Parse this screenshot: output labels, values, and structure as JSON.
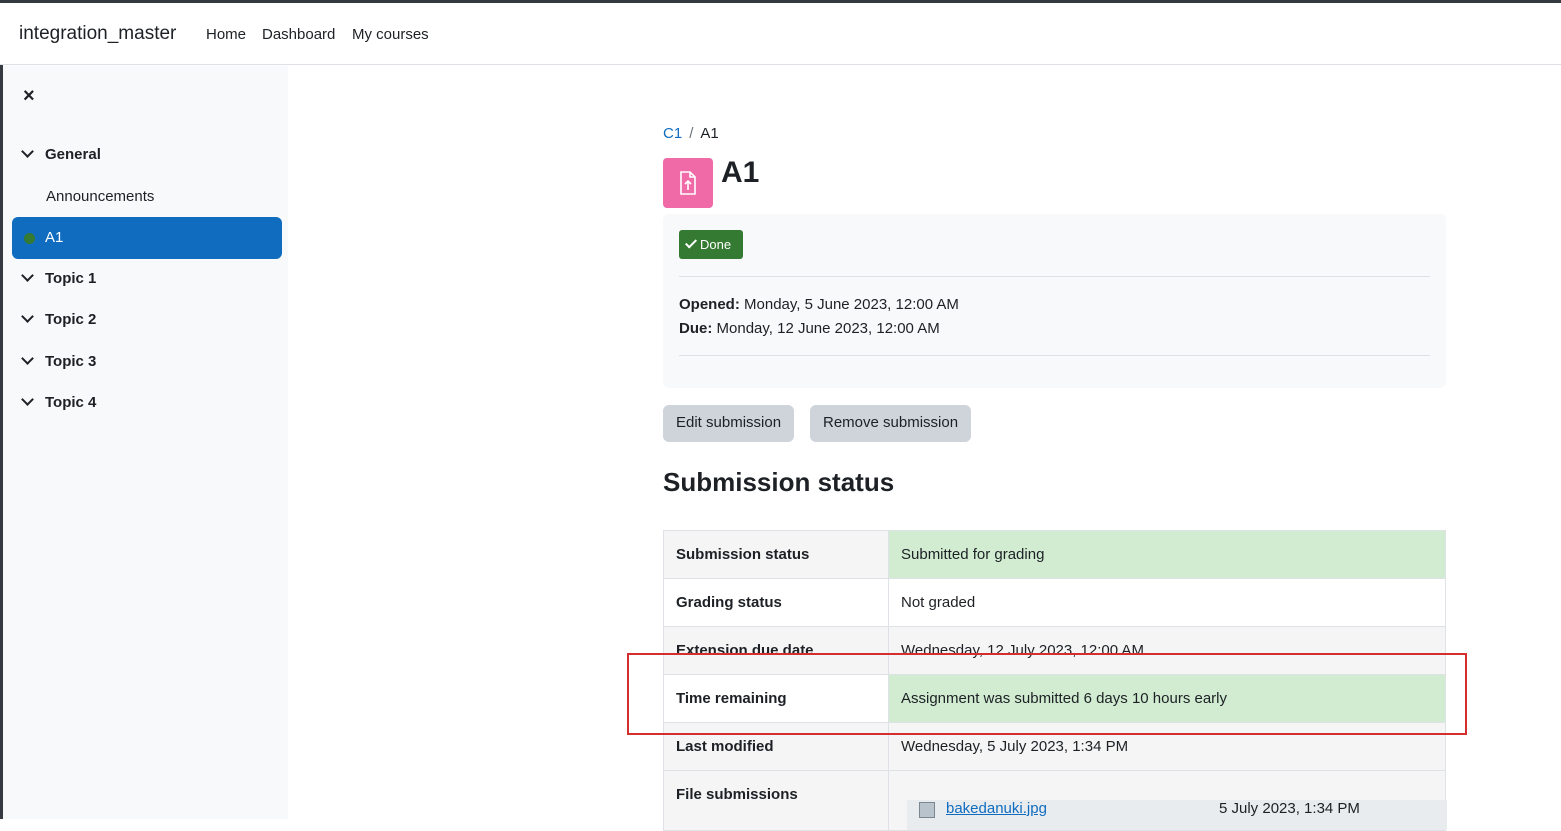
{
  "navbar": {
    "brand": "integration_master",
    "links": [
      "Home",
      "Dashboard",
      "My courses"
    ]
  },
  "drawer": {
    "close": "×",
    "sections": [
      "General",
      "Topic 1",
      "Topic 2",
      "Topic 3",
      "Topic 4"
    ],
    "items": [
      "Announcements",
      "A1"
    ]
  },
  "breadcrumb": {
    "course": "C1",
    "separator": "/",
    "current": "A1"
  },
  "page": {
    "title": "A1"
  },
  "activity": {
    "badge": "Done",
    "opened_label": "Opened:",
    "opened_value": " Monday, 5 June 2023, 12:00 AM",
    "due_label": "Due:",
    "due_value": " Monday, 12 June 2023, 12:00 AM"
  },
  "buttons": {
    "edit": "Edit submission",
    "remove": "Remove submission"
  },
  "submission": {
    "heading": "Submission status",
    "rows": [
      {
        "label": "Submission status",
        "value": "Submitted for grading"
      },
      {
        "label": "Grading status",
        "value": "Not graded"
      },
      {
        "label": "Extension due date",
        "value": "Wednesday, 12 July 2023, 12:00 AM"
      },
      {
        "label": "Time remaining",
        "value": "Assignment was submitted 6 days 10 hours early"
      },
      {
        "label": "Last modified",
        "value": "Wednesday, 5 July 2023, 1:34 PM"
      },
      {
        "label": "File submissions",
        "file_name": "bakedanuki.jpg",
        "file_date": "5 July 2023, 1:34 PM"
      }
    ]
  },
  "colors": {
    "primary": "#0f6cbf",
    "success": "#357a32",
    "success_bg": "#d1ecd1",
    "assign_icon": "#f06aa8",
    "highlight": "#d32f2f"
  }
}
